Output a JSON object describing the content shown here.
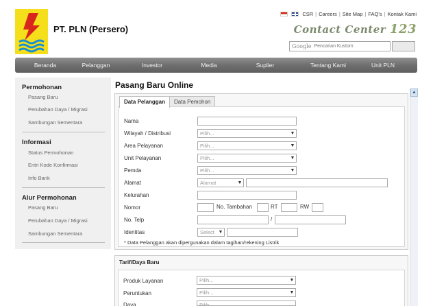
{
  "header": {
    "company": "PT. PLN (Persero)",
    "top_links": [
      "CSR",
      "Careers",
      "Site Map",
      "FAQ's",
      "Kontak Kami"
    ],
    "separator": "|",
    "contact_center_text": "Contact Center",
    "contact_center_number": "123",
    "search_brand": "Google",
    "search_placeholder": "Pencarian Kustom"
  },
  "nav": [
    "Beranda",
    "Pelanggan",
    "Investor",
    "Media",
    "Suplier",
    "Tentang Kami",
    "Unit PLN"
  ],
  "sidebar": {
    "sections": [
      {
        "title": "Permohonan",
        "links": [
          "Pasang Baru",
          "Perubahan Daya / Migrasi",
          "Sambungan Sementara"
        ]
      },
      {
        "title": "Informasi",
        "links": [
          "Status Permohonan",
          "Entri Kode Konfirmasi",
          "Info Bank"
        ]
      },
      {
        "title": "Alur Permohonan",
        "links": [
          "Pasang Baru",
          "Perubahan Daya / Migrasi",
          "Sambungan Sementara"
        ]
      }
    ]
  },
  "main": {
    "title": "Pasang Baru Online",
    "tabs": [
      "Data Pelanggan",
      "Data Pemohon"
    ],
    "fields": {
      "nama": "Nama",
      "wilayah": "Wilayah / Distribusi",
      "area": "Area Pelayanan",
      "unit": "Unit Pelayanan",
      "pemda": "Pemda",
      "alamat": "Alamat",
      "kelurahan": "Kelurahan",
      "nomor": "Nomor",
      "no_tambahan": "No. Tambahan",
      "rt": "RT",
      "rw": "RW",
      "no_telp": "No. Telp",
      "telp_sep": "/",
      "identitas": "Identitas"
    },
    "select_placeholder": "Pilih...",
    "alamat_select": "Alamat",
    "identitas_select": "Select",
    "note": "* Data Pelanggan akan dipergunakan dalam tagihan/rekening Listrik",
    "tarif": {
      "title": "Tarif/Daya Baru",
      "fields": [
        "Produk Layanan",
        "Peruntukan",
        "Daya"
      ]
    }
  }
}
